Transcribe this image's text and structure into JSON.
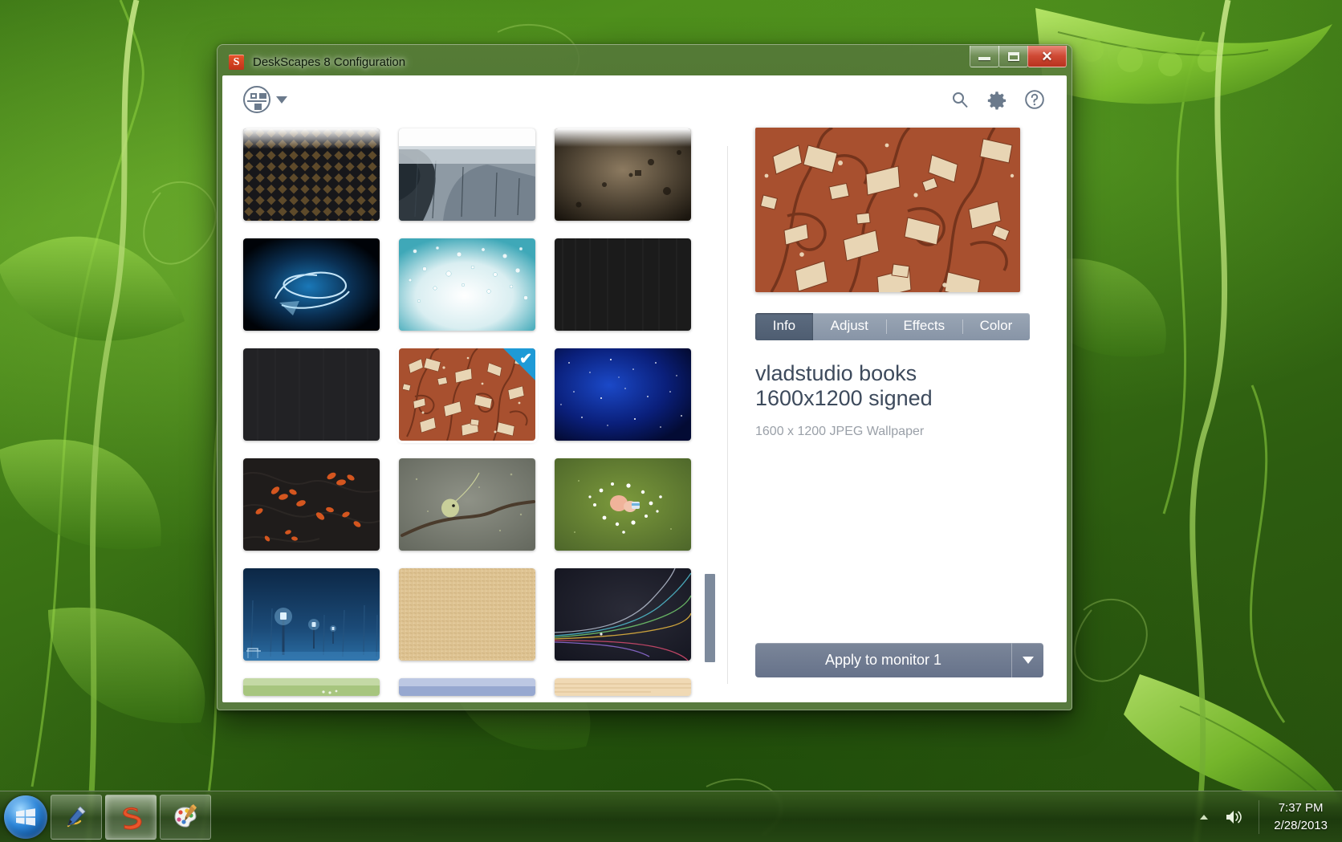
{
  "desktop": {
    "wallpaper_description": "green pea pod vines wallpaper"
  },
  "window": {
    "title": "DeskScapes 8 Configuration",
    "app_icon": "S",
    "controls": {
      "minimize": "minimize-icon",
      "maximize": "maximize-icon",
      "close": "✕"
    }
  },
  "toolbar": {
    "view_switch_icon": "view-layout-icon",
    "view_switch_caret": "chevron-down-icon",
    "search_icon": "search-icon",
    "settings_icon": "gear-icon",
    "help_icon": "help-icon"
  },
  "grid": {
    "items": [
      {
        "name": "dark-diamond-pattern",
        "selected": false,
        "partial": false
      },
      {
        "name": "grey-winter-forest",
        "selected": false,
        "partial": false
      },
      {
        "name": "brown-grunge-texture",
        "selected": false,
        "partial": false
      },
      {
        "name": "blue-light-swirl",
        "selected": false,
        "partial": false
      },
      {
        "name": "water-droplets-teal",
        "selected": false,
        "partial": false
      },
      {
        "name": "black-brushed-metal",
        "selected": false,
        "partial": false
      },
      {
        "name": "dark-vertical-lines",
        "selected": false,
        "partial": false
      },
      {
        "name": "vladstudio-books",
        "selected": true,
        "partial": false
      },
      {
        "name": "blue-starfield",
        "selected": false,
        "partial": false
      },
      {
        "name": "orange-leaves-dark",
        "selected": false,
        "partial": false
      },
      {
        "name": "bird-on-branch-grey",
        "selected": false,
        "partial": false
      },
      {
        "name": "green-flowers-field",
        "selected": false,
        "partial": false
      },
      {
        "name": "snowy-night-lamps",
        "selected": false,
        "partial": false
      },
      {
        "name": "sand-texture-tan",
        "selected": false,
        "partial": false
      },
      {
        "name": "dark-color-strands",
        "selected": false,
        "partial": false
      },
      {
        "name": "green-partial",
        "selected": false,
        "partial": true
      },
      {
        "name": "blue-partial",
        "selected": false,
        "partial": true
      },
      {
        "name": "tan-partial",
        "selected": false,
        "partial": true
      }
    ],
    "selected_badge_check": "✔",
    "scrollbar": "vertical-scrollbar"
  },
  "detail": {
    "preview_image": "vladstudio-books-preview",
    "tabs": [
      {
        "label": "Info",
        "active": true
      },
      {
        "label": "Adjust",
        "active": false
      },
      {
        "label": "Effects",
        "active": false
      },
      {
        "label": "Color",
        "active": false
      }
    ],
    "title": "vladstudio books 1600x1200 signed",
    "subtitle": "1600 x 1200 JPEG Wallpaper",
    "apply_label": "Apply to monitor 1",
    "apply_caret": "chevron-down-icon"
  },
  "taskbar": {
    "start_label": "start-orb",
    "buttons": [
      {
        "name": "snipping-tool",
        "active": false
      },
      {
        "name": "deskscapes",
        "active": true
      },
      {
        "name": "paint",
        "active": false
      }
    ],
    "tray": {
      "show_hidden_icons": "chevron-up-icon",
      "volume": "speaker-icon"
    },
    "clock": {
      "time": "7:37 PM",
      "date": "2/28/2013"
    }
  },
  "colors": {
    "accent": "#1e9ad6",
    "tab_active": "#4e5d71",
    "button": "#66728a",
    "title_text": "#3d4a5c",
    "subtitle_text": "#9aa0a8",
    "close_button": "#cf4a35"
  }
}
